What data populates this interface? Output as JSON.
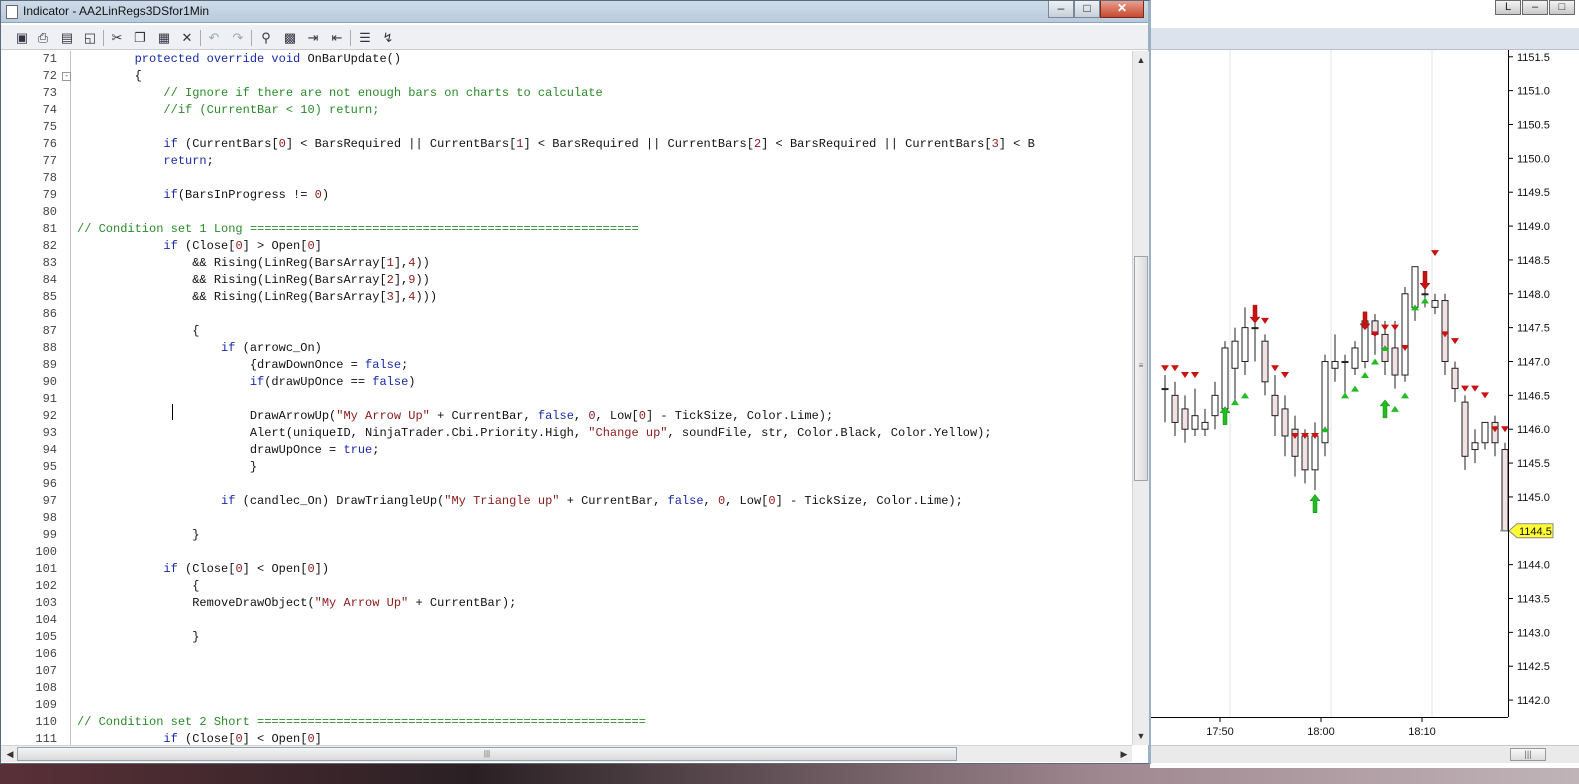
{
  "window": {
    "title": "Indicator - AA2LinRegs3DSfor1Min",
    "minimize": "‒",
    "maximize": "□",
    "close": "✕"
  },
  "toolbar": {
    "icons": [
      "save-icon",
      "print-icon",
      "print-preview-icon",
      "page-setup-icon",
      "cut-icon",
      "copy-icon",
      "paste-icon",
      "delete-icon",
      "undo-icon",
      "redo-icon",
      "find-icon",
      "replace-icon",
      "indent-icon",
      "outdent-icon",
      "comment-icon",
      "uncomment-icon"
    ]
  },
  "editor": {
    "lines": [
      {
        "n": "71",
        "segs": [
          [
            "",
            "        "
          ],
          [
            "kw",
            "protected override void"
          ],
          [
            "",
            " OnBarUpdate()"
          ]
        ]
      },
      {
        "n": "72",
        "fold": "-",
        "segs": [
          [
            "",
            "        {"
          ]
        ]
      },
      {
        "n": "73",
        "segs": [
          [
            "",
            "            "
          ],
          [
            "cm",
            "// Ignore if there are not enough bars on charts to calculate"
          ]
        ]
      },
      {
        "n": "74",
        "segs": [
          [
            "",
            "            "
          ],
          [
            "cm",
            "//if (CurrentBar < 10) return;"
          ]
        ]
      },
      {
        "n": "75",
        "segs": []
      },
      {
        "n": "76",
        "segs": [
          [
            "",
            "            "
          ],
          [
            "kw",
            "if"
          ],
          [
            "",
            " (CurrentBars["
          ],
          [
            "nm",
            "0"
          ],
          [
            "",
            "] < BarsRequired || CurrentBars["
          ],
          [
            "nm",
            "1"
          ],
          [
            "",
            "] < BarsRequired || CurrentBars["
          ],
          [
            "nm",
            "2"
          ],
          [
            "",
            "] < BarsRequired || CurrentBars["
          ],
          [
            "nm",
            "3"
          ],
          [
            "",
            "] < B"
          ]
        ]
      },
      {
        "n": "77",
        "segs": [
          [
            "",
            "            "
          ],
          [
            "kw",
            "return"
          ],
          [
            "",
            ";"
          ]
        ]
      },
      {
        "n": "78",
        "segs": []
      },
      {
        "n": "79",
        "segs": [
          [
            "",
            "            "
          ],
          [
            "kw",
            "if"
          ],
          [
            "",
            "(BarsInProgress != "
          ],
          [
            "nm",
            "0"
          ],
          [
            "",
            ")"
          ]
        ]
      },
      {
        "n": "80",
        "segs": []
      },
      {
        "n": "81",
        "segs": [
          [
            "cm",
            "// Condition set 1 Long ======================================================"
          ]
        ]
      },
      {
        "n": "82",
        "segs": [
          [
            "",
            "            "
          ],
          [
            "kw",
            "if"
          ],
          [
            "",
            " (Close["
          ],
          [
            "nm",
            "0"
          ],
          [
            "",
            "] > Open["
          ],
          [
            "nm",
            "0"
          ],
          [
            "",
            "]"
          ]
        ]
      },
      {
        "n": "83",
        "segs": [
          [
            "",
            "                && Rising(LinReg(BarsArray["
          ],
          [
            "nm",
            "1"
          ],
          [
            "",
            "],"
          ],
          [
            "nm",
            "4"
          ],
          [
            "",
            "))"
          ]
        ]
      },
      {
        "n": "84",
        "segs": [
          [
            "",
            "                && Rising(LinReg(BarsArray["
          ],
          [
            "nm",
            "2"
          ],
          [
            "",
            "],"
          ],
          [
            "nm",
            "9"
          ],
          [
            "",
            "))"
          ]
        ]
      },
      {
        "n": "85",
        "segs": [
          [
            "",
            "                && Rising(LinReg(BarsArray["
          ],
          [
            "nm",
            "3"
          ],
          [
            "",
            "],"
          ],
          [
            "nm",
            "4"
          ],
          [
            "",
            ")))"
          ]
        ]
      },
      {
        "n": "86",
        "segs": []
      },
      {
        "n": "87",
        "segs": [
          [
            "",
            "                {"
          ]
        ]
      },
      {
        "n": "88",
        "segs": [
          [
            "",
            "                    "
          ],
          [
            "kw",
            "if"
          ],
          [
            "",
            " (arrowc_On)"
          ]
        ]
      },
      {
        "n": "89",
        "segs": [
          [
            "",
            "                        {drawDownOnce = "
          ],
          [
            "kw",
            "false"
          ],
          [
            "",
            ";"
          ]
        ]
      },
      {
        "n": "90",
        "segs": [
          [
            "",
            "                        "
          ],
          [
            "kw",
            "if"
          ],
          [
            "",
            "(drawUpOnce == "
          ],
          [
            "kw",
            "false"
          ],
          [
            "",
            ")"
          ]
        ]
      },
      {
        "n": "91",
        "segs": []
      },
      {
        "n": "92",
        "segs": [
          [
            "",
            "                        DrawArrowUp("
          ],
          [
            "st",
            "\"My Arrow Up\""
          ],
          [
            "",
            " + CurrentBar, "
          ],
          [
            "kw",
            "false"
          ],
          [
            "",
            ", "
          ],
          [
            "nm",
            "0"
          ],
          [
            "",
            ", Low["
          ],
          [
            "nm",
            "0"
          ],
          [
            "",
            "] - TickSize, Color.Lime);"
          ]
        ]
      },
      {
        "n": "93",
        "segs": [
          [
            "",
            "                        Alert(uniqueID, NinjaTrader.Cbi.Priority.High, "
          ],
          [
            "st",
            "\"Change up\""
          ],
          [
            "",
            ", soundFile, str, Color.Black, Color.Yellow);"
          ]
        ]
      },
      {
        "n": "94",
        "segs": [
          [
            "",
            "                        drawUpOnce = "
          ],
          [
            "kw",
            "true"
          ],
          [
            "",
            ";"
          ]
        ]
      },
      {
        "n": "95",
        "segs": [
          [
            "",
            "                        }"
          ]
        ]
      },
      {
        "n": "96",
        "segs": []
      },
      {
        "n": "97",
        "segs": [
          [
            "",
            "                    "
          ],
          [
            "kw",
            "if"
          ],
          [
            "",
            " (candlec_On) DrawTriangleUp("
          ],
          [
            "st",
            "\"My Triangle up\""
          ],
          [
            "",
            " + CurrentBar, "
          ],
          [
            "kw",
            "false"
          ],
          [
            "",
            ", "
          ],
          [
            "nm",
            "0"
          ],
          [
            "",
            ", Low["
          ],
          [
            "nm",
            "0"
          ],
          [
            "",
            "] - TickSize, Color.Lime);"
          ]
        ]
      },
      {
        "n": "98",
        "segs": []
      },
      {
        "n": "99",
        "segs": [
          [
            "",
            "                }"
          ]
        ]
      },
      {
        "n": "100",
        "segs": []
      },
      {
        "n": "101",
        "segs": [
          [
            "",
            "            "
          ],
          [
            "kw",
            "if"
          ],
          [
            "",
            " (Close["
          ],
          [
            "nm",
            "0"
          ],
          [
            "",
            "] < Open["
          ],
          [
            "nm",
            "0"
          ],
          [
            "",
            "])"
          ]
        ]
      },
      {
        "n": "102",
        "segs": [
          [
            "",
            "                {"
          ]
        ]
      },
      {
        "n": "103",
        "segs": [
          [
            "",
            "                RemoveDrawObject("
          ],
          [
            "st",
            "\"My Arrow Up\""
          ],
          [
            "",
            " + CurrentBar);"
          ]
        ]
      },
      {
        "n": "104",
        "segs": []
      },
      {
        "n": "105",
        "segs": [
          [
            "",
            "                }"
          ]
        ]
      },
      {
        "n": "106",
        "segs": []
      },
      {
        "n": "107",
        "segs": []
      },
      {
        "n": "108",
        "segs": []
      },
      {
        "n": "109",
        "segs": []
      },
      {
        "n": "110",
        "segs": [
          [
            "cm",
            "// Condition set 2 Short ======================================================"
          ]
        ]
      },
      {
        "n": "111",
        "segs": [
          [
            "",
            "            "
          ],
          [
            "kw",
            "if"
          ],
          [
            "",
            " (Close["
          ],
          [
            "nm",
            "0"
          ],
          [
            "",
            "] < Open["
          ],
          [
            "nm",
            "0"
          ],
          [
            "",
            "]"
          ]
        ]
      }
    ]
  },
  "chart": {
    "window_buttons": [
      "L",
      "‒",
      "□"
    ],
    "price_labels": [
      "1151.5",
      "1151.0",
      "1150.5",
      "1150.0",
      "1149.5",
      "1149.0",
      "1148.5",
      "1148.0",
      "1147.5",
      "1147.0",
      "1146.5",
      "1146.0",
      "1145.5",
      "1145.0",
      "1144.5",
      "1144.0",
      "1143.5",
      "1143.0",
      "1142.5",
      "1142.0"
    ],
    "time_labels": [
      "17:50",
      "18:00",
      "18:10"
    ],
    "current_price": "1144.5",
    "colors": {
      "up_bar": "#ffffff",
      "down_bar": "#f2e2e4",
      "up_marker": "#22bb22",
      "down_marker": "#cc1111",
      "current_price_bg": "#ffff33"
    }
  },
  "chart_data": {
    "type": "candlestick",
    "y_range": [
      1141.75,
      1151.6
    ],
    "bars": [
      {
        "o": 1146.6,
        "h": 1146.8,
        "l": 1146.1,
        "c": 1146.6
      },
      {
        "o": 1146.5,
        "h": 1146.7,
        "l": 1145.9,
        "c": 1146.1
      },
      {
        "o": 1146.3,
        "h": 1146.5,
        "l": 1145.8,
        "c": 1146.0
      },
      {
        "o": 1146.0,
        "h": 1146.6,
        "l": 1145.9,
        "c": 1146.2
      },
      {
        "o": 1146.0,
        "h": 1146.3,
        "l": 1145.9,
        "c": 1146.1
      },
      {
        "o": 1146.2,
        "h": 1146.7,
        "l": 1146.0,
        "c": 1146.5
      },
      {
        "o": 1146.3,
        "h": 1147.3,
        "l": 1146.2,
        "c": 1147.2
      },
      {
        "o": 1146.9,
        "h": 1147.5,
        "l": 1146.4,
        "c": 1147.3
      },
      {
        "o": 1147.0,
        "h": 1147.8,
        "l": 1146.8,
        "c": 1147.5
      },
      {
        "o": 1147.5,
        "h": 1147.6,
        "l": 1147.0,
        "c": 1147.5
      },
      {
        "o": 1147.3,
        "h": 1147.4,
        "l": 1146.5,
        "c": 1146.7
      },
      {
        "o": 1146.5,
        "h": 1146.8,
        "l": 1145.9,
        "c": 1146.2
      },
      {
        "o": 1146.3,
        "h": 1146.5,
        "l": 1145.6,
        "c": 1145.9
      },
      {
        "o": 1146.0,
        "h": 1146.2,
        "l": 1145.3,
        "c": 1145.6
      },
      {
        "o": 1145.9,
        "h": 1146.0,
        "l": 1145.2,
        "c": 1145.4
      },
      {
        "o": 1145.4,
        "h": 1146.1,
        "l": 1145.1,
        "c": 1145.9
      },
      {
        "o": 1145.8,
        "h": 1147.1,
        "l": 1145.6,
        "c": 1147.0
      },
      {
        "o": 1146.9,
        "h": 1147.4,
        "l": 1146.7,
        "c": 1147.0
      },
      {
        "o": 1147.0,
        "h": 1147.1,
        "l": 1146.5,
        "c": 1147.0
      },
      {
        "o": 1146.9,
        "h": 1147.3,
        "l": 1146.8,
        "c": 1147.2
      },
      {
        "o": 1147.0,
        "h": 1147.7,
        "l": 1146.9,
        "c": 1147.6
      },
      {
        "o": 1147.6,
        "h": 1147.7,
        "l": 1147.1,
        "c": 1147.4
      },
      {
        "o": 1147.4,
        "h": 1147.6,
        "l": 1146.8,
        "c": 1147.0
      },
      {
        "o": 1147.2,
        "h": 1147.6,
        "l": 1146.6,
        "c": 1146.8
      },
      {
        "o": 1146.8,
        "h": 1148.1,
        "l": 1146.7,
        "c": 1148.0
      },
      {
        "o": 1147.8,
        "h": 1148.4,
        "l": 1147.6,
        "c": 1148.4
      },
      {
        "o": 1148.0,
        "h": 1148.3,
        "l": 1147.8,
        "c": 1148.0
      },
      {
        "o": 1147.8,
        "h": 1148.0,
        "l": 1147.7,
        "c": 1147.9
      },
      {
        "o": 1147.9,
        "h": 1148.0,
        "l": 1146.8,
        "c": 1147.0
      },
      {
        "o": 1146.9,
        "h": 1147.0,
        "l": 1146.4,
        "c": 1146.6
      },
      {
        "o": 1146.4,
        "h": 1146.5,
        "l": 1145.4,
        "c": 1145.6
      },
      {
        "o": 1145.7,
        "h": 1146.0,
        "l": 1145.5,
        "c": 1145.8
      },
      {
        "o": 1145.8,
        "h": 1146.1,
        "l": 1145.7,
        "c": 1146.1
      },
      {
        "o": 1146.1,
        "h": 1146.2,
        "l": 1145.6,
        "c": 1145.8
      },
      {
        "o": 1145.7,
        "h": 1145.8,
        "l": 1144.5,
        "c": 1144.5
      },
      {
        "o": 1144.6,
        "h": 1144.8,
        "l": 1144.3,
        "c": 1144.5
      }
    ],
    "up_markers": [
      [
        7,
        1146.4
      ],
      [
        8,
        1146.5
      ],
      [
        15,
        1145.0
      ],
      [
        16,
        1146.0
      ],
      [
        18,
        1146.5
      ],
      [
        19,
        1146.6
      ],
      [
        20,
        1146.8
      ],
      [
        21,
        1147.0
      ],
      [
        22,
        1147.2
      ],
      [
        23,
        1146.3
      ],
      [
        24,
        1146.5
      ],
      [
        25,
        1147.8
      ],
      [
        26,
        1147.9
      ]
    ],
    "down_markers": [
      [
        0,
        1146.9
      ],
      [
        1,
        1146.9
      ],
      [
        2,
        1146.8
      ],
      [
        3,
        1146.8
      ],
      [
        10,
        1147.6
      ],
      [
        11,
        1146.9
      ],
      [
        12,
        1146.8
      ],
      [
        13,
        1145.9
      ],
      [
        14,
        1145.9
      ],
      [
        15,
        1145.9
      ],
      [
        21,
        1147.4
      ],
      [
        22,
        1147.5
      ],
      [
        23,
        1147.5
      ],
      [
        24,
        1147.2
      ],
      [
        26,
        1148.1
      ],
      [
        27,
        1148.6
      ],
      [
        28,
        1147.4
      ],
      [
        29,
        1147.3
      ],
      [
        30,
        1146.6
      ],
      [
        31,
        1146.6
      ],
      [
        32,
        1146.5
      ],
      [
        33,
        1146.0
      ],
      [
        34,
        1146.0
      ],
      [
        35,
        1145.5
      ],
      [
        35,
        1146.2
      ]
    ]
  }
}
